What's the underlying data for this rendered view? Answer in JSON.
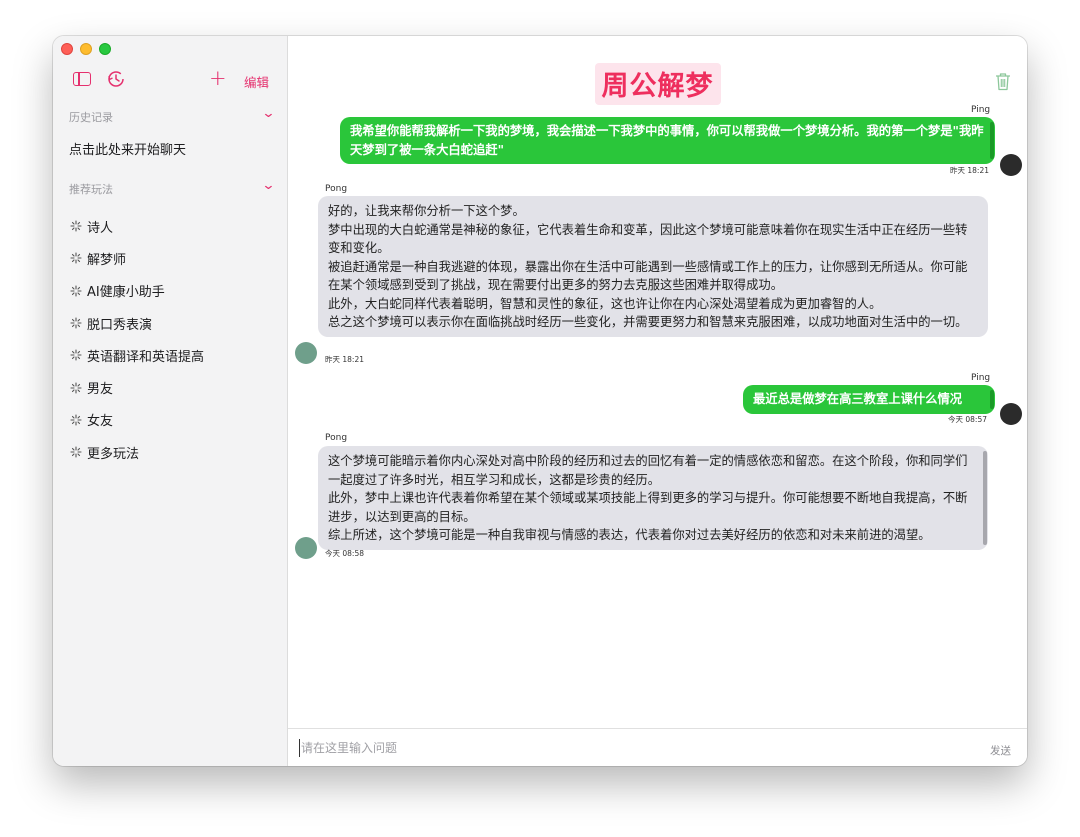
{
  "sidebar": {
    "edit_label": "编辑",
    "history_header": "历史记录",
    "history_items": [
      "点击此处来开始聊天"
    ],
    "recommend_header": "推荐玩法",
    "recommend_items": [
      "诗人",
      "解梦师",
      "AI健康小助手",
      "脱口秀表演",
      "英语翻译和英语提高",
      "男友",
      "女友",
      "更多玩法"
    ]
  },
  "main": {
    "title": "周公解梦",
    "messages": [
      {
        "sender": "Ping",
        "text": "我希望你能帮我解析一下我的梦境，我会描述一下我梦中的事情，你可以帮我做一个梦境分析。我的第一个梦是\"我昨天梦到了被一条大白蛇追赶\"",
        "time": "昨天 18:21"
      },
      {
        "sender": "Pong",
        "paragraphs": [
          "好的，让我来帮你分析一下这个梦。",
          "梦中出现的大白蛇通常是神秘的象征，它代表着生命和变革，因此这个梦境可能意味着你在现实生活中正在经历一些转变和变化。",
          "被追赶通常是一种自我逃避的体现，暴露出你在生活中可能遇到一些感情或工作上的压力，让你感到无所适从。你可能在某个领域感到受到了挑战，现在需要付出更多的努力去克服这些困难并取得成功。",
          "此外，大白蛇同样代表着聪明，智慧和灵性的象征，这也许让你在内心深处渴望着成为更加睿智的人。",
          "总之这个梦境可以表示你在面临挑战时经历一些变化，并需要更努力和智慧来克服困难，以成功地面对生活中的一切。"
        ],
        "time": "昨天 18:21"
      },
      {
        "sender": "Ping",
        "text": "最近总是做梦在高三教室上课什么情况",
        "time": "今天 08:57"
      },
      {
        "sender": "Pong",
        "paragraphs": [
          "这个梦境可能暗示着你内心深处对高中阶段的经历和过去的回忆有着一定的情感依恋和留恋。在这个阶段，你和同学们一起度过了许多时光，相互学习和成长，这都是珍贵的经历。",
          "此外，梦中上课也许代表着你希望在某个领域或某项技能上得到更多的学习与提升。你可能想要不断地自我提高，不断进步，以达到更高的目标。",
          "综上所述，这个梦境可能是一种自我审视与情感的表达，代表着你对过去美好经历的依恋和对未来前进的渴望。"
        ],
        "time": "今天 08:58"
      }
    ]
  },
  "input": {
    "placeholder": "请在这里输入问题",
    "send_label": "发送"
  },
  "colors": {
    "accent": "#e5306e",
    "title_text": "#ee2f5e",
    "title_bg": "#fde4ec",
    "outgoing_bubble": "#2ac63a",
    "incoming_bubble": "#e2e2e8"
  },
  "icons": [
    "sidebar-toggle-icon",
    "clock-icon",
    "plus-icon",
    "chevron-down-icon",
    "sparkle-icon",
    "trash-icon"
  ]
}
